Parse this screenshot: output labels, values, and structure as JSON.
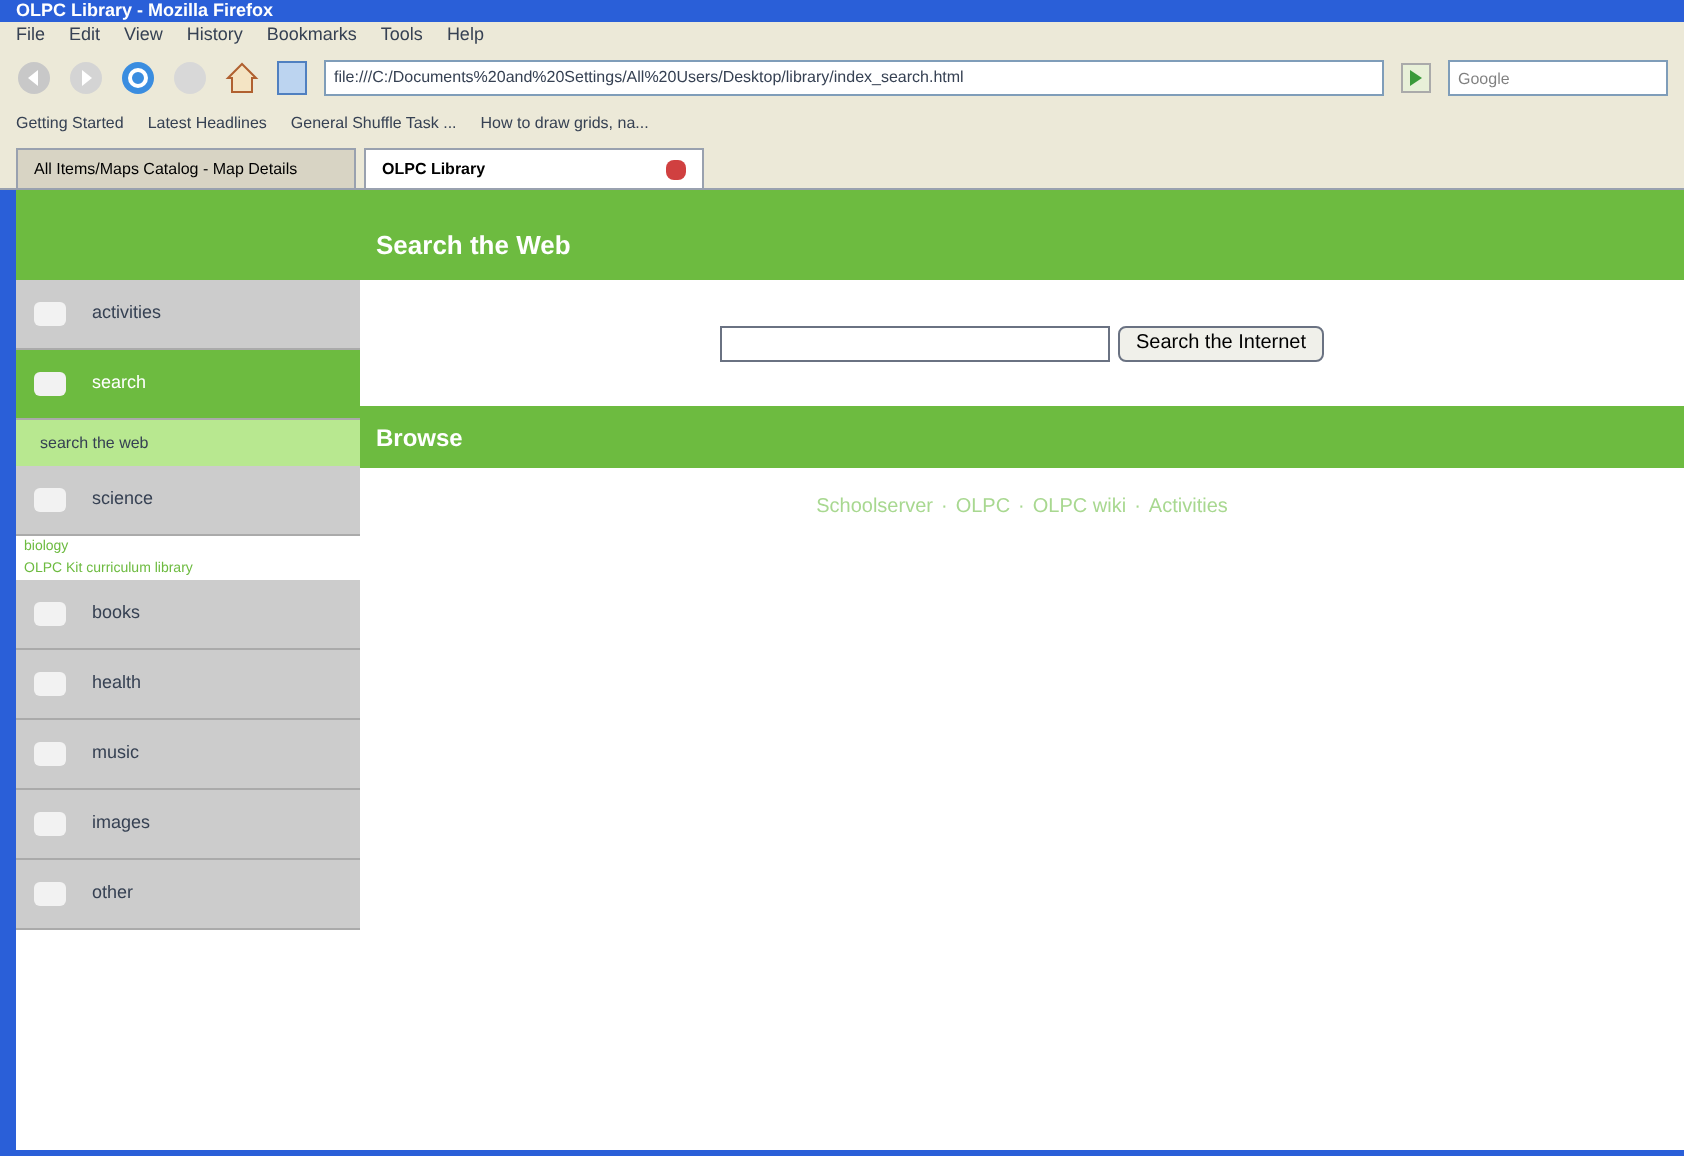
{
  "window": {
    "title": "OLPC Library - Mozilla Firefox"
  },
  "menu": [
    "File",
    "Edit",
    "View",
    "History",
    "Bookmarks",
    "Tools",
    "Help"
  ],
  "address": {
    "value": "file:///C:/Documents%20and%20Settings/All%20Users/Desktop/library/index_search.html"
  },
  "search_box": {
    "placeholder": "Google"
  },
  "bookmarks": [
    "Getting Started",
    "Latest Headlines",
    "General Shuffle Task ...",
    "How to draw grids, na..."
  ],
  "tabs": [
    {
      "label": "All Items/Maps Catalog - Map Details",
      "selected": false
    },
    {
      "label": "OLPC Library",
      "selected": true
    }
  ],
  "sidebar": [
    {
      "label": "activities",
      "kind": "item",
      "selected": false
    },
    {
      "label": "search",
      "kind": "item",
      "selected": true
    },
    {
      "label": "search the web",
      "kind": "sub",
      "selected": true
    },
    {
      "label": "science",
      "kind": "item",
      "selected": false
    },
    {
      "label": "biology",
      "kind": "link"
    },
    {
      "label": "OLPC Kit curriculum library",
      "kind": "link"
    },
    {
      "label": "books",
      "kind": "item",
      "selected": false
    },
    {
      "label": "health",
      "kind": "item",
      "selected": false
    },
    {
      "label": "music",
      "kind": "item",
      "selected": false
    },
    {
      "label": "images",
      "kind": "item",
      "selected": false
    },
    {
      "label": "other",
      "kind": "item",
      "selected": false
    }
  ],
  "search_section": {
    "title": "Search the Web",
    "button": "Search the Internet"
  },
  "browse_section": {
    "title": "Browse",
    "links": [
      "Schoolserver",
      "OLPC",
      "OLPC wiki",
      "Activities"
    ],
    "separator": "·"
  }
}
